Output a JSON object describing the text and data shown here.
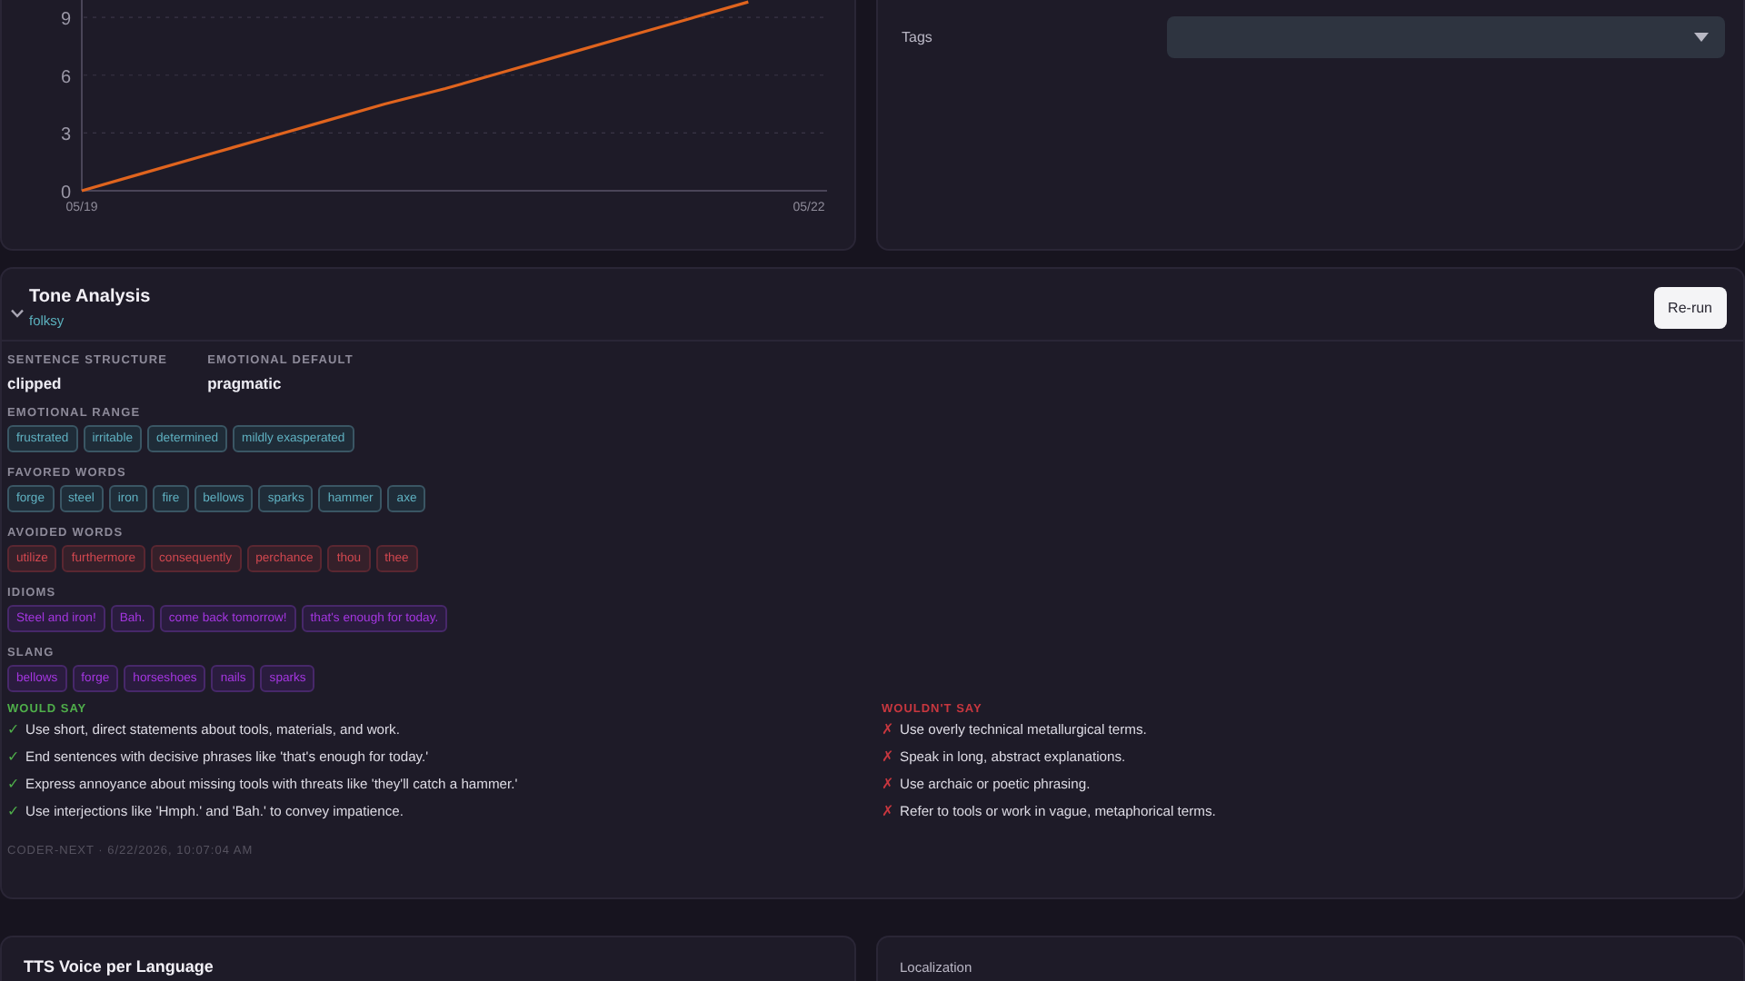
{
  "chart_card": {
    "chart_data": {
      "type": "line",
      "categories": [
        "05/19",
        null,
        null,
        null,
        null,
        null,
        null,
        null,
        null,
        null,
        null,
        null,
        "05/22"
      ],
      "ylim": [
        0,
        9.9
      ],
      "yticks": [
        0,
        3,
        6,
        9
      ],
      "grid": true,
      "series": [
        {
          "color": "#e0641e",
          "values": [
            0,
            0.9,
            1.8,
            2.7,
            3.6,
            4.5,
            5.3,
            6.2,
            7.1,
            8,
            8.9,
            9.8,
            null
          ]
        }
      ]
    }
  },
  "tags_card": {
    "label": "Tags"
  },
  "tone_analysis": {
    "title": "Tone Analysis",
    "subtitle": "folksy",
    "expanded": true,
    "rerun_button": "Re-run",
    "fields": [
      {
        "label": "SENTENCE STRUCTURE",
        "value": "clipped"
      },
      {
        "label": "EMOTIONAL DEFAULT",
        "value": "pragmatic"
      }
    ],
    "tag_groups": [
      {
        "label": "EMOTIONAL RANGE",
        "kind": "teal",
        "tags": [
          "frustrated",
          "irritable",
          "determined",
          "mildly exasperated"
        ]
      },
      {
        "label": "FAVORED WORDS",
        "kind": "teal",
        "tags": [
          "forge",
          "steel",
          "iron",
          "fire",
          "bellows",
          "sparks",
          "hammer",
          "axe"
        ]
      },
      {
        "label": "AVOIDED WORDS",
        "kind": "red",
        "tags": [
          "utilize",
          "furthermore",
          "consequently",
          "perchance",
          "thou",
          "thee"
        ]
      },
      {
        "label": "IDIOMS",
        "kind": "purple",
        "tags": [
          "Steel and iron!",
          "Bah.",
          "come back tomorrow!",
          "that's enough for today."
        ]
      },
      {
        "label": "SLANG",
        "kind": "purple",
        "tags": [
          "bellows",
          "forge",
          "horseshoes",
          "nails",
          "sparks"
        ]
      }
    ],
    "lists": [
      {
        "heading": "WOULD SAY",
        "kind": "good",
        "mark": "✓",
        "items": [
          "Use short, direct statements about tools, materials, and work.",
          "End sentences with decisive phrases like 'that's enough for today.'",
          "Express annoyance about missing tools with threats like 'they'll catch a hammer.'",
          "Use interjections like 'Hmph.' and 'Bah.' to convey impatience."
        ]
      },
      {
        "heading": "WOULDN'T SAY",
        "kind": "bad",
        "mark": "✗",
        "items": [
          "Use overly technical metallurgical terms.",
          "Speak in long, abstract explanations.",
          "Use archaic or poetic phrasing.",
          "Refer to tools or work in vague, metaphorical terms."
        ]
      }
    ],
    "footer": "CODER-NEXT · 6/22/2026, 10:07:04 AM"
  },
  "bottom_cards": [
    {
      "title": "TTS Voice per Language",
      "kind": "heading"
    },
    {
      "title": "Localization",
      "kind": "label"
    }
  ]
}
